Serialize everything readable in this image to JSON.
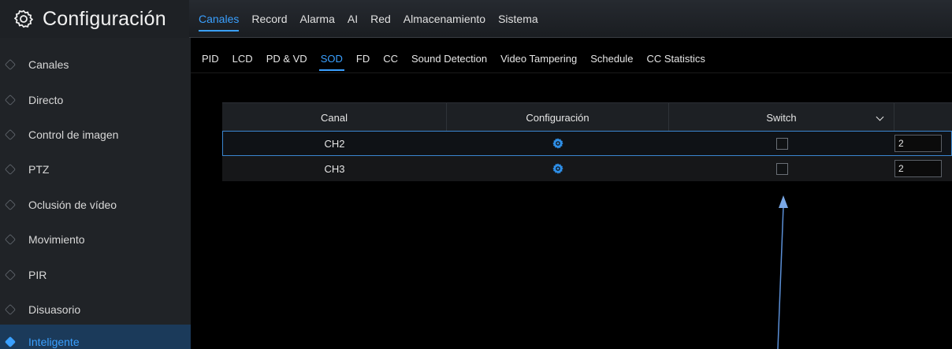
{
  "header": {
    "title": "Configuración",
    "tabs": [
      "Canales",
      "Record",
      "Alarma",
      "AI",
      "Red",
      "Almacenamiento",
      "Sistema"
    ],
    "active_tab": "Canales"
  },
  "sidebar": {
    "items": [
      {
        "label": "Canales"
      },
      {
        "label": "Directo"
      },
      {
        "label": "Control de imagen"
      },
      {
        "label": "PTZ"
      },
      {
        "label": "Oclusión de vídeo"
      },
      {
        "label": "Movimiento"
      },
      {
        "label": "PIR"
      },
      {
        "label": "Disuasorio"
      },
      {
        "label": "Inteligente"
      }
    ],
    "active": "Inteligente"
  },
  "subtabs": {
    "items": [
      "PID",
      "LCD",
      "PD & VD",
      "SOD",
      "FD",
      "CC",
      "Sound Detection",
      "Video Tampering",
      "Schedule",
      "CC Statistics"
    ],
    "active": "SOD"
  },
  "table": {
    "headers": {
      "channel": "Canal",
      "config": "Configuración",
      "switch": "Switch"
    },
    "rows": [
      {
        "channel": "CH2",
        "switch_checked": false,
        "value": "2",
        "selected": true
      },
      {
        "channel": "CH3",
        "switch_checked": false,
        "value": "2",
        "selected": false
      }
    ]
  },
  "colors": {
    "accent": "#3aa0ff",
    "sidebar_bg": "#202327",
    "active_item_bg": "#1b3a5a",
    "annotation_arrow": "#5b8fd6"
  },
  "icons": {
    "brand": "gear-icon",
    "config": "gear-icon",
    "sidebar_bullet": "diamond-icon",
    "switch_dropdown": "chevron-down-icon"
  }
}
